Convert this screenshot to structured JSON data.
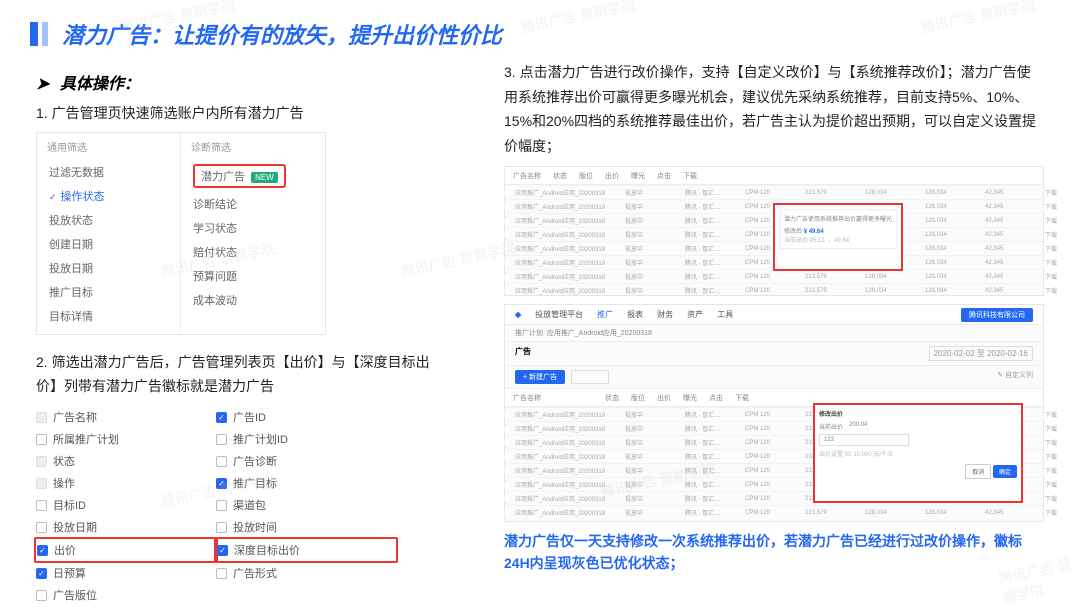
{
  "title": "潜力广告：让提价有的放矢，提升出价性价比",
  "section_heading": "具体操作：",
  "steps": {
    "s1": "1. 广告管理页快速筛选账户内所有潜力广告",
    "s2": "2. 筛选出潜力广告后，广告管理列表页【出价】与【深度目标出价】列带有潜力广告徽标就是潜力广告",
    "s3": "3. 点击潜力广告进行改价操作，支持【自定义改价】与【系统推荐改价】；潜力广告使用系统推荐出价可赢得更多曝光机会，建议优先采纳系统推荐，目前支持5%、10%、15%和20%四档的系统推荐最佳出价，若广告主认为提价超出预期，可以自定义设置提价幅度；"
  },
  "filter": {
    "left_head": "通用筛选",
    "right_head": "诊断筛选",
    "left_items": [
      "过滤无数据",
      "操作状态",
      "投放状态",
      "创建日期",
      "投放日期",
      "推广目标",
      "目标详情"
    ],
    "right_items_hl": "潜力广告",
    "right_items_hl_tag": "NEW",
    "right_items": [
      "诊断结论",
      "学习状态",
      "赔付状态",
      "预算问题",
      "成本波动"
    ]
  },
  "checks": {
    "left": [
      {
        "label": "广告名称",
        "on": false,
        "dis": true
      },
      {
        "label": "所属推广计划",
        "on": false
      },
      {
        "label": "状态",
        "on": false,
        "dis": true
      },
      {
        "label": "操作",
        "on": true,
        "dis": true
      },
      {
        "label": "目标ID",
        "on": false
      },
      {
        "label": "投放日期",
        "on": false
      },
      {
        "label": "出价",
        "on": true,
        "hl": true
      },
      {
        "label": "日预算",
        "on": true
      },
      {
        "label": "广告版位",
        "on": false
      }
    ],
    "right": [
      {
        "label": "广告ID",
        "on": true
      },
      {
        "label": "推广计划ID",
        "on": false
      },
      {
        "label": "广告诊断",
        "on": false
      },
      {
        "label": "推广目标",
        "on": true
      },
      {
        "label": "渠道包",
        "on": false
      },
      {
        "label": "投放时间",
        "on": false
      },
      {
        "label": "深度目标出价",
        "on": true,
        "hl": true
      },
      {
        "label": "广告形式",
        "on": false
      },
      {
        "label": "",
        "on": false,
        "blank": true
      }
    ]
  },
  "shot_rows": [
    "应用推广_Android应用_20200318",
    "应用推广_Android应用_20200318",
    "应用推广_Android应用_20200318",
    "应用推广_Android应用_20200318",
    "应用推广_Android应用_20200318",
    "应用推广_Android应用_20200318",
    "应用推广_Android应用_20200318",
    "应用推广_Android应用_20200318"
  ],
  "shot_cols": [
    "投放中",
    "腾讯 · 智汇…",
    "CPM 120",
    "213,579",
    "128,034",
    "128,034",
    "42,345",
    "下载"
  ],
  "popup1": {
    "line1": "潜力广告使用系统推荐出价赢得更多曝光",
    "label": "修改后",
    "val": "¥ 49.64",
    "hint": "当前出价 45.13 → 49.64"
  },
  "platform_title": "投放管理平台",
  "platform_tabs": [
    "推广",
    "报表",
    "财务",
    "资产",
    "工具"
  ],
  "platform_sub": "推广计划: 应用推广_Android应用_20200318",
  "platform_section": "广告",
  "date_range": "2020-02-02 至 2020-02-16",
  "popup2": {
    "title": "修改出价",
    "cur_label": "当前出价",
    "cur_val": "200.04",
    "input_val": "123",
    "range": "出价设置 50-10,000 元/千次",
    "cancel": "取消",
    "ok": "确定"
  },
  "footer_note": "潜力广告仅一天支持修改一次系统推荐出价，若潜力广告已经进行过改价操作，徽标24H内呈现灰色已优化状态；",
  "watermark_text": "腾讯广告  营销学院"
}
